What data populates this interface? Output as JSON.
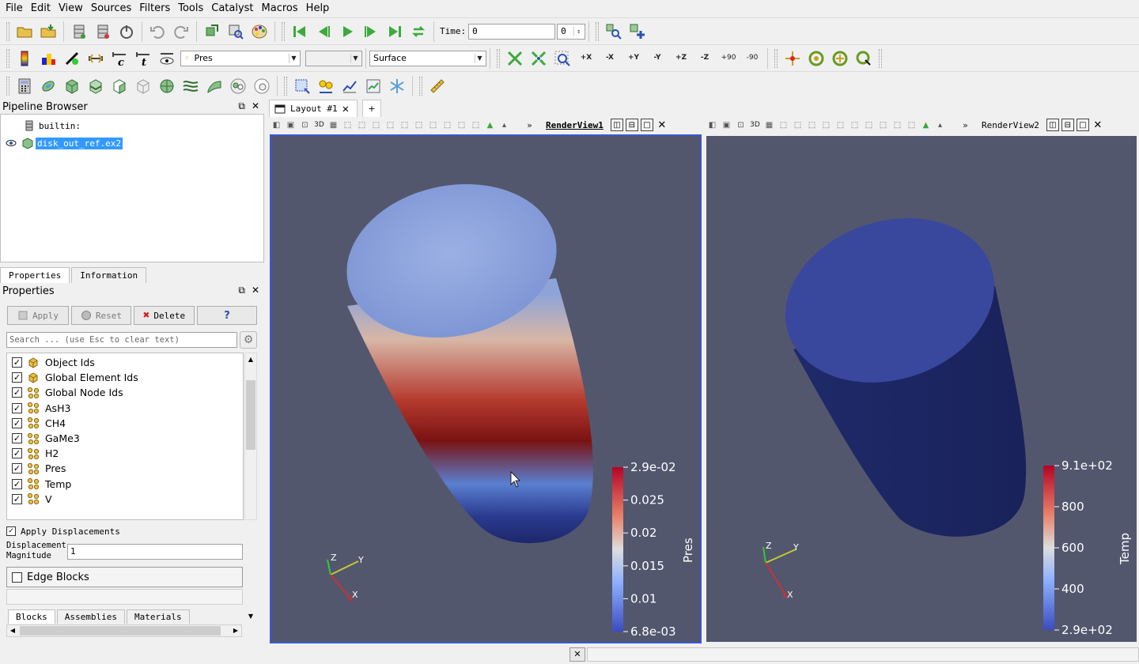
{
  "menu": [
    "File",
    "Edit",
    "View",
    "Sources",
    "Filters",
    "Tools",
    "Catalyst",
    "Macros",
    "Help"
  ],
  "toolbar_time": {
    "label": "Time:",
    "value": "0",
    "index": "0"
  },
  "toolbar_color": {
    "variable": "Pres",
    "representation": "Surface"
  },
  "camera_buttons": [
    "+X",
    "-X",
    "+Y",
    "-Y",
    "+Z",
    "-Z",
    "+90",
    "-90"
  ],
  "pipeline": {
    "title": "Pipeline Browser",
    "items": [
      "builtin:",
      "disk_out_ref.ex2"
    ]
  },
  "properties": {
    "tabs": [
      "Properties",
      "Information"
    ],
    "title": "Properties",
    "apply": "Apply",
    "reset": "Reset",
    "delete": "Delete",
    "help": "?",
    "search_placeholder": "Search ... (use Esc to clear text)",
    "variables": [
      {
        "name": "Object Ids",
        "icon": "cell"
      },
      {
        "name": "Global Element Ids",
        "icon": "cell"
      },
      {
        "name": "Global Node Ids",
        "icon": "point"
      },
      {
        "name": "AsH3",
        "icon": "point"
      },
      {
        "name": "CH4",
        "icon": "point"
      },
      {
        "name": "GaMe3",
        "icon": "point"
      },
      {
        "name": "H2",
        "icon": "point"
      },
      {
        "name": "Pres",
        "icon": "point"
      },
      {
        "name": "Temp",
        "icon": "point"
      },
      {
        "name": "V",
        "icon": "point"
      }
    ],
    "apply_displacements": "Apply Displacements",
    "displacement_label_1": "Displacement",
    "displacement_label_2": "Magnitude",
    "displacement_value": "1",
    "edge_blocks": "Edge Blocks",
    "bottom_tabs": [
      "Blocks",
      "Assemblies",
      "Materials"
    ]
  },
  "layout": {
    "tab": "Layout #1",
    "add": "+"
  },
  "view1": {
    "title": "RenderView1",
    "colorbar": {
      "label": "Pres",
      "ticks": [
        "2.9e-02",
        "0.025",
        "0.02",
        "0.015",
        "0.01",
        "6.8e-03"
      ]
    }
  },
  "view2": {
    "title": "RenderView2",
    "colorbar": {
      "label": "Temp",
      "ticks": [
        "9.1e+02",
        "800",
        "600",
        "400",
        "2.9e+02"
      ]
    }
  },
  "axes": {
    "x": "X",
    "y": "Y",
    "z": "Z"
  },
  "colors": {
    "view_bg": "#52576e",
    "accent": "#3b58d6",
    "selection": "#3399ff"
  }
}
